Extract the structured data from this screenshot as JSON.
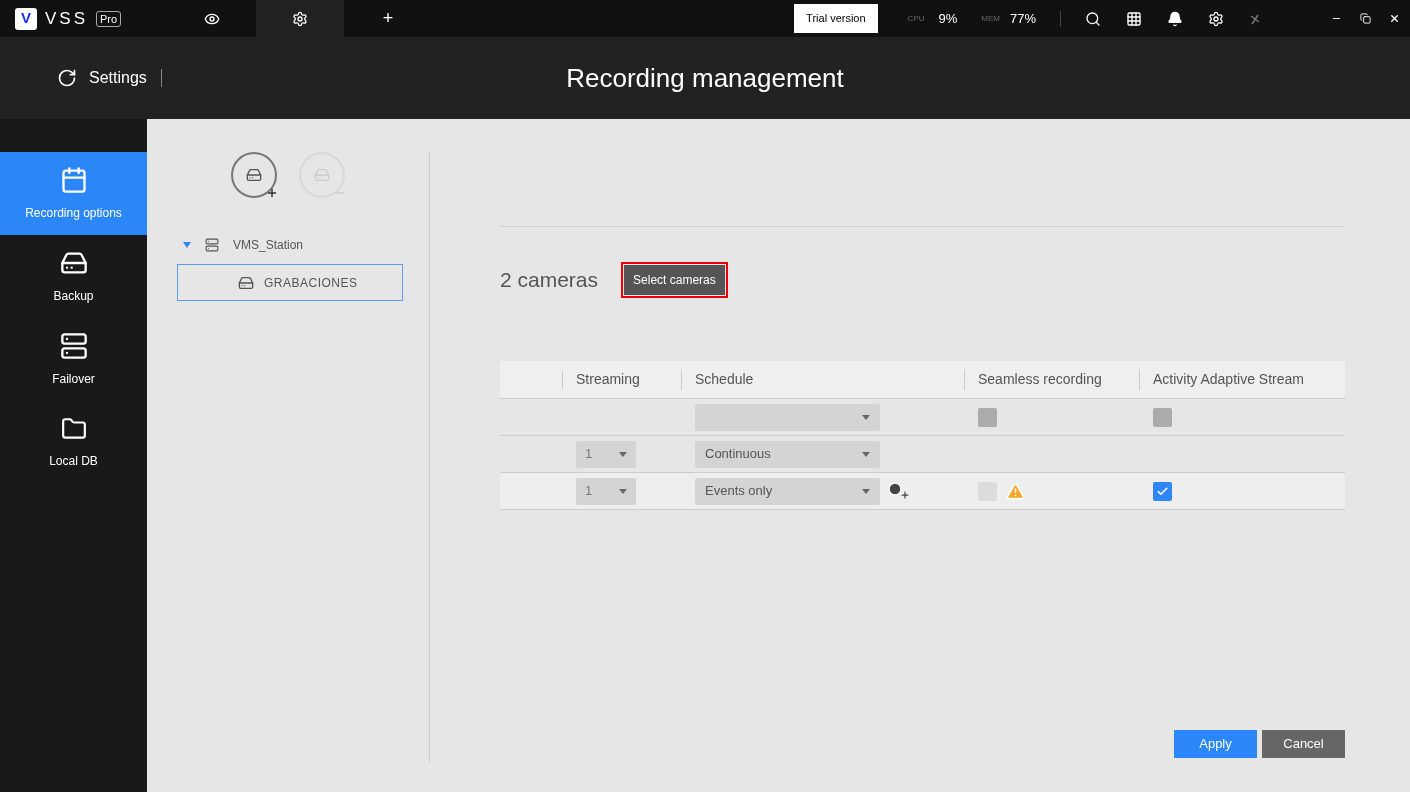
{
  "app": {
    "logo_letter": "V",
    "name": "VSS",
    "edition": "Pro"
  },
  "top_tabs": [
    {
      "kind": "eye",
      "selected": false
    },
    {
      "kind": "gear",
      "selected": true
    },
    {
      "kind": "plus",
      "selected": false
    }
  ],
  "top_tabs_plus": "+",
  "trial": "Trial version",
  "cpu": {
    "label": "CPU",
    "value": "9%"
  },
  "mem": {
    "label": "MEM",
    "value": "77%"
  },
  "header": {
    "section": "Settings",
    "title": "Recording management"
  },
  "sidebar": [
    {
      "kind": "calendar",
      "label": "Recording options",
      "selected": true
    },
    {
      "kind": "backup",
      "label": "Backup",
      "selected": false
    },
    {
      "kind": "failover",
      "label": "Failover",
      "selected": false
    },
    {
      "kind": "localdb",
      "label": "Local DB",
      "selected": false
    }
  ],
  "tree": {
    "label": "VMS_Station",
    "expanded": true,
    "children": [
      {
        "label": "GRABACIONES",
        "selected": true
      }
    ]
  },
  "camera_count": "2 cameras",
  "select_button": "Select cameras",
  "table": {
    "columns": [
      "Streaming",
      "Schedule",
      "Seamless recording",
      "Activity Adaptive Stream"
    ],
    "rows": [
      {
        "kind": "bulk",
        "stream": null,
        "schedule": "",
        "seamless": false,
        "adaptive": false,
        "warning": false,
        "add_schedule": false
      },
      {
        "kind": "camera",
        "stream": "1",
        "schedule": "Continuous",
        "seamless": null,
        "adaptive": null,
        "warning": false,
        "add_schedule": false
      },
      {
        "kind": "camera",
        "stream": "1",
        "schedule": "Events only",
        "seamless": false,
        "adaptive": true,
        "warning": true,
        "add_schedule": true
      }
    ]
  },
  "buttons": {
    "apply": "Apply",
    "cancel": "Cancel"
  }
}
